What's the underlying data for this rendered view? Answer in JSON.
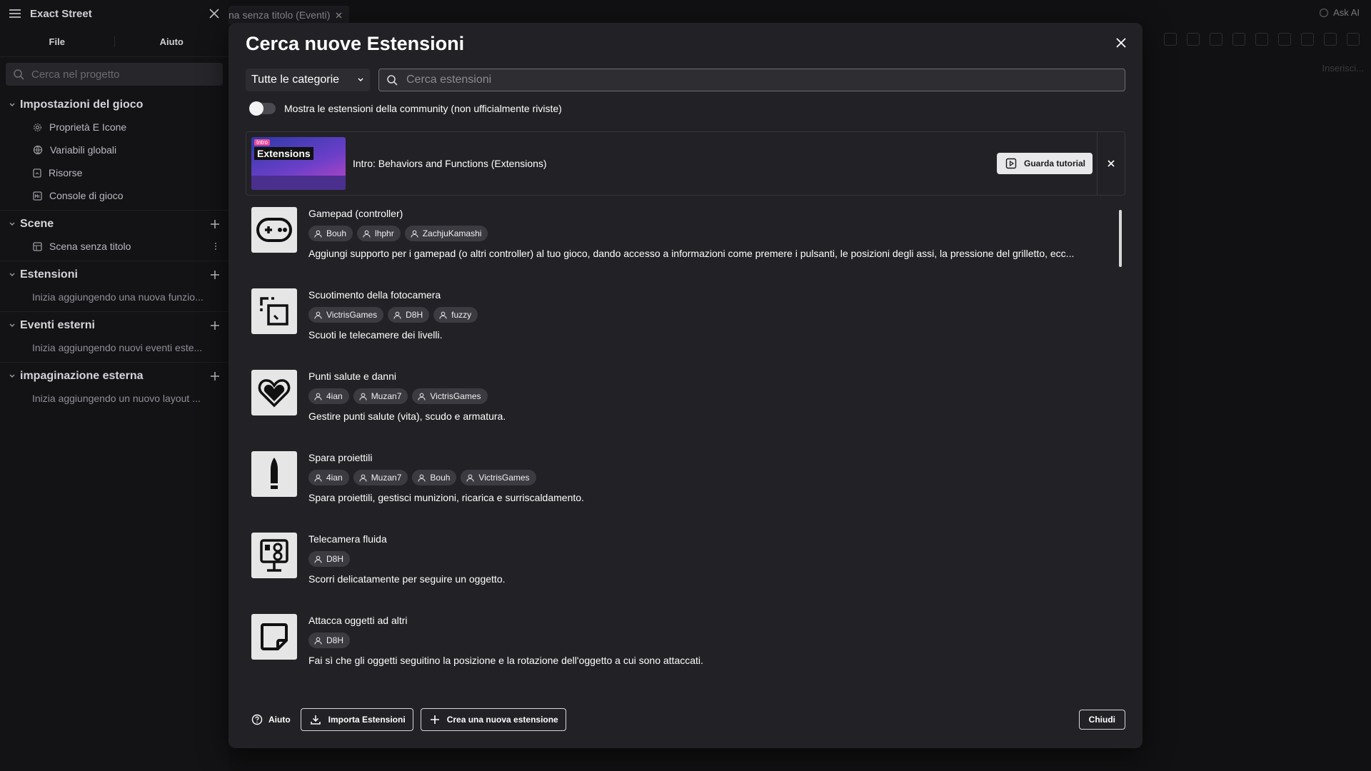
{
  "app": {
    "project_name": "Exact Street"
  },
  "sidebar": {
    "tabs": [
      "File",
      "Aiuto"
    ],
    "search_placeholder": "Cerca nel progetto",
    "sections": {
      "game_settings": {
        "label": "Impostazioni del gioco",
        "items": [
          "Proprietà E Icone",
          "Variabili globali",
          "Risorse",
          "Console di gioco"
        ]
      },
      "scenes": {
        "label": "Scene",
        "items": [
          "Scena senza titolo"
        ]
      },
      "extensions": {
        "label": "Estensioni",
        "empty": "Inizia aggiungendo una nuova funzio..."
      },
      "external_events": {
        "label": "Eventi esterni",
        "empty": "Inizia aggiungendo nuovi eventi este..."
      },
      "external_layout": {
        "label": "impaginazione esterna",
        "empty": "Inizia aggiungendo un nuovo layout ..."
      }
    }
  },
  "background": {
    "tab_label": "na senza titolo (Eventi)",
    "ask_ai": "Ask AI",
    "insert": "Inserisci..."
  },
  "modal": {
    "title": "Cerca nuove Estensioni",
    "category_select": "Tutte le categorie",
    "search_placeholder": "Cerca estensioni",
    "community_toggle_label": "Mostra le estensioni della community (non ufficialmente riviste)",
    "community_toggle_on": false,
    "tutorial": {
      "thumb_badge": "Intro",
      "thumb_title": "Extensions",
      "title": "Intro: Behaviors and Functions (Extensions)",
      "button": "Guarda tutorial"
    },
    "extensions": [
      {
        "name": "Gamepad (controller)",
        "icon": "gamepad-icon",
        "authors": [
          "Bouh",
          "lhphr",
          "ZachjuKamashi"
        ],
        "description": "Aggiungi supporto per i gamepad (o altri controller) al tuo gioco, dando accesso a informazioni come premere i pulsanti, le posizioni degli assi, la pressione del grilletto, ecc..."
      },
      {
        "name": "Scuotimento della fotocamera",
        "icon": "camera-shake-icon",
        "authors": [
          "VictrisGames",
          "D8H",
          "fuzzy"
        ],
        "description": "Scuoti le telecamere dei livelli."
      },
      {
        "name": "Punti salute e danni",
        "icon": "heart-icon",
        "authors": [
          "4ian",
          "Muzan7",
          "VictrisGames"
        ],
        "description": "Gestire punti salute (vita), scudo e armatura."
      },
      {
        "name": "Spara proiettili",
        "icon": "bullet-icon",
        "authors": [
          "4ian",
          "Muzan7",
          "Bouh",
          "VictrisGames"
        ],
        "description": "Spara proiettili, gestisci munizioni, ricarica e surriscaldamento."
      },
      {
        "name": "Telecamera fluida",
        "icon": "smooth-camera-icon",
        "authors": [
          "D8H"
        ],
        "description": "Scorri delicatamente per seguire un oggetto."
      },
      {
        "name": "Attacca oggetti ad altri",
        "icon": "sticker-icon",
        "authors": [
          "D8H"
        ],
        "description": "Fai sì che gli oggetti seguitino la posizione e la rotazione dell'oggetto a cui sono attaccati."
      }
    ],
    "footer": {
      "help": "Aiuto",
      "import": "Importa Estensioni",
      "create": "Crea una nuova estensione",
      "close": "Chiudi"
    }
  }
}
